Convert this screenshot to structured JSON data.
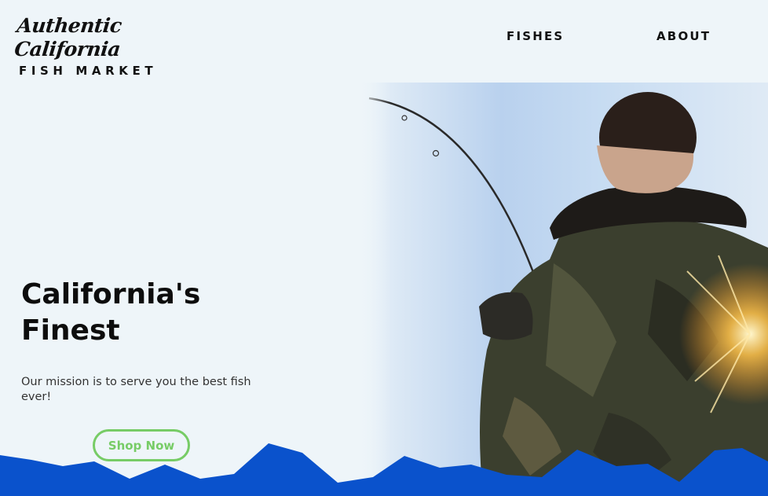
{
  "brand": {
    "script_line": "Authentic California",
    "sub_line": "FISH MARKET"
  },
  "nav": {
    "items": [
      {
        "label": "FISHES"
      },
      {
        "label": "ABOUT"
      }
    ]
  },
  "hero": {
    "title_line1": "California's",
    "title_line2": "Finest",
    "subtitle": "Our mission is to serve you the best fish ever!",
    "cta_label": "Shop Now",
    "image_description_name": "fisherman-photo"
  },
  "colors": {
    "background": "#eef5f9",
    "cta_green": "#77cc66",
    "wave_blue": "#0a52cc",
    "text_dark": "#0d0d0d"
  }
}
